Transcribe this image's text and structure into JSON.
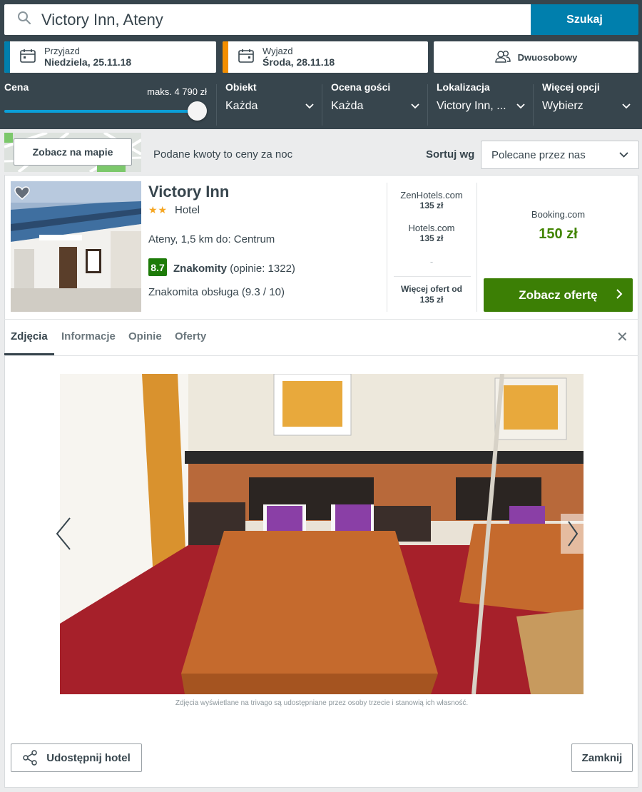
{
  "search": {
    "value": "Victory Inn, Ateny",
    "button_label": "Szukaj"
  },
  "checkin": {
    "label": "Przyjazd",
    "value": "Niedziela, 25.11.18",
    "stripe_color": "#007fad"
  },
  "checkout": {
    "label": "Wyjazd",
    "value": "Środa, 28.11.18",
    "stripe_color": "#f48f00"
  },
  "room": {
    "label": "Dwuosobowy",
    "icon": "two-users-icon"
  },
  "filters": {
    "price": {
      "title": "Cena",
      "max_label": "maks. 4 790 zł",
      "slider_level": 1.0
    },
    "property": {
      "title": "Obiekt",
      "value": "Każda"
    },
    "guest_rating": {
      "title": "Ocena gości",
      "value": "Każda"
    },
    "location": {
      "title": "Lokalizacja",
      "value": "Victory Inn, ..."
    },
    "more": {
      "title": "Więcej opcji",
      "value": "Wybierz"
    }
  },
  "results_bar": {
    "map_button": "Zobacz na mapie",
    "price_note": "Podane kwoty to ceny za noc",
    "sort_label": "Sortuj wg",
    "sort_value": "Polecane przez nas"
  },
  "hotel": {
    "name": "Victory Inn",
    "stars": "★★",
    "star_count": 2,
    "type": "Hotel",
    "location": "Ateny, 1,5 km do: Centrum",
    "score": "8.7",
    "rating_word": "Znakomity",
    "rating_count": "(opinie: 1322)",
    "highlight": "Znakomita obsługa (9.3 / 10)"
  },
  "offers": {
    "providers": [
      {
        "name": "ZenHotels.com",
        "price": "135 zł"
      },
      {
        "name": "Hotels.com",
        "price": "135 zł"
      }
    ],
    "placeholder": "-",
    "more_label": "Więcej ofert od",
    "more_price": "135 zł",
    "best": {
      "name": "Booking.com",
      "price": "150 zł"
    },
    "cta": "Zobacz ofertę"
  },
  "tabs": [
    {
      "label": "Zdjęcia",
      "active": true
    },
    {
      "label": "Informacje",
      "active": false
    },
    {
      "label": "Opinie",
      "active": false
    },
    {
      "label": "Oferty",
      "active": false
    }
  ],
  "gallery": {
    "credit": "Zdjęcia wyświetlane na trivago są udostępniane przez osoby trzecie i stanowią ich własność."
  },
  "footer": {
    "share_label": "Udostępnij hotel",
    "close_label": "Zamknij"
  },
  "colors": {
    "header_bg": "#37454d",
    "search_button": "#007fad",
    "cta_green": "#3c7f05",
    "price_green": "#428500",
    "score_green": "#1d7b08"
  }
}
